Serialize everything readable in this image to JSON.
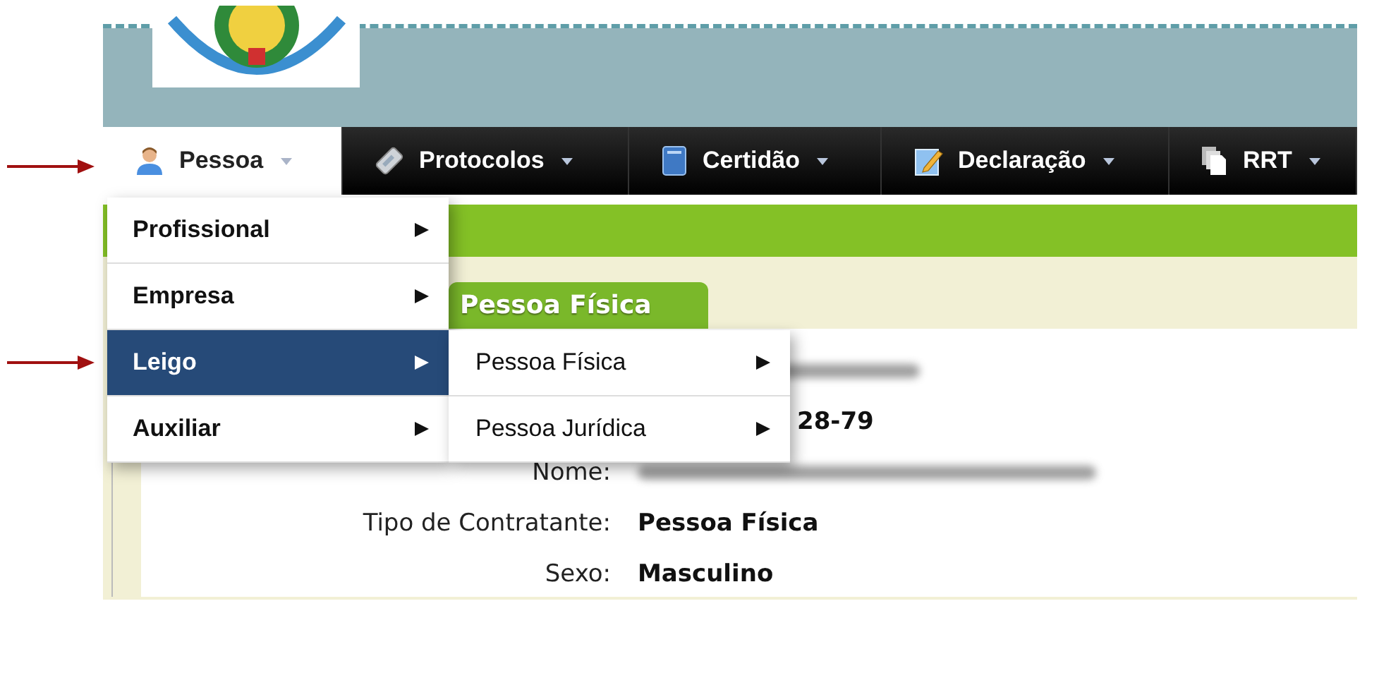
{
  "nav": [
    {
      "label": "Pessoa",
      "kind": "person",
      "selected": true
    },
    {
      "label": "Protocolos",
      "kind": "ticket",
      "selected": false
    },
    {
      "label": "Certidão",
      "kind": "book",
      "selected": false
    },
    {
      "label": "Declaração",
      "kind": "notepad",
      "selected": false
    },
    {
      "label": "RRT",
      "kind": "copies",
      "selected": false
    }
  ],
  "menu": [
    {
      "label": "Profissional",
      "selected": false
    },
    {
      "label": "Empresa",
      "selected": false
    },
    {
      "label": "Leigo",
      "selected": true
    },
    {
      "label": "Auxiliar",
      "selected": false
    }
  ],
  "submenu": [
    {
      "label": "Pessoa Física"
    },
    {
      "label": "Pessoa Jurídica"
    }
  ],
  "tab": {
    "label": "Pessoa Física"
  },
  "fields": [
    {
      "kind": "redacted"
    },
    {
      "kind": "covered",
      "value": "28-79"
    },
    {
      "kind": "redacted",
      "label": "Nome:"
    },
    {
      "kind": "text",
      "label": "Tipo de Contratante:",
      "value": "Pessoa Física"
    },
    {
      "kind": "text",
      "label": "Sexo:",
      "value": "Masculino"
    }
  ]
}
